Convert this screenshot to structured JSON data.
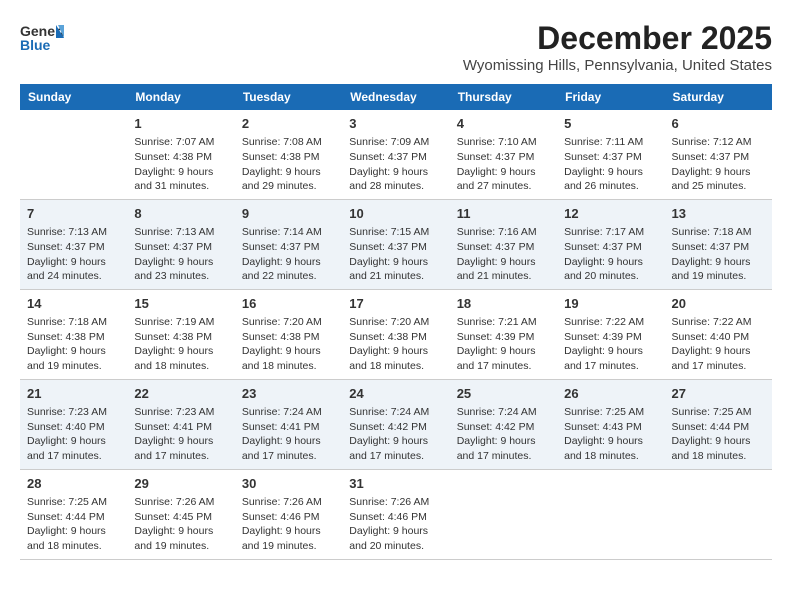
{
  "header": {
    "logo_general": "General",
    "logo_blue": "Blue",
    "month_title": "December 2025",
    "location": "Wyomissing Hills, Pennsylvania, United States"
  },
  "days_of_week": [
    "Sunday",
    "Monday",
    "Tuesday",
    "Wednesday",
    "Thursday",
    "Friday",
    "Saturday"
  ],
  "weeks": [
    [
      {
        "day": "",
        "info": ""
      },
      {
        "day": "1",
        "info": "Sunrise: 7:07 AM\nSunset: 4:38 PM\nDaylight: 9 hours\nand 31 minutes."
      },
      {
        "day": "2",
        "info": "Sunrise: 7:08 AM\nSunset: 4:38 PM\nDaylight: 9 hours\nand 29 minutes."
      },
      {
        "day": "3",
        "info": "Sunrise: 7:09 AM\nSunset: 4:37 PM\nDaylight: 9 hours\nand 28 minutes."
      },
      {
        "day": "4",
        "info": "Sunrise: 7:10 AM\nSunset: 4:37 PM\nDaylight: 9 hours\nand 27 minutes."
      },
      {
        "day": "5",
        "info": "Sunrise: 7:11 AM\nSunset: 4:37 PM\nDaylight: 9 hours\nand 26 minutes."
      },
      {
        "day": "6",
        "info": "Sunrise: 7:12 AM\nSunset: 4:37 PM\nDaylight: 9 hours\nand 25 minutes."
      }
    ],
    [
      {
        "day": "7",
        "info": "Sunrise: 7:13 AM\nSunset: 4:37 PM\nDaylight: 9 hours\nand 24 minutes."
      },
      {
        "day": "8",
        "info": "Sunrise: 7:13 AM\nSunset: 4:37 PM\nDaylight: 9 hours\nand 23 minutes."
      },
      {
        "day": "9",
        "info": "Sunrise: 7:14 AM\nSunset: 4:37 PM\nDaylight: 9 hours\nand 22 minutes."
      },
      {
        "day": "10",
        "info": "Sunrise: 7:15 AM\nSunset: 4:37 PM\nDaylight: 9 hours\nand 21 minutes."
      },
      {
        "day": "11",
        "info": "Sunrise: 7:16 AM\nSunset: 4:37 PM\nDaylight: 9 hours\nand 21 minutes."
      },
      {
        "day": "12",
        "info": "Sunrise: 7:17 AM\nSunset: 4:37 PM\nDaylight: 9 hours\nand 20 minutes."
      },
      {
        "day": "13",
        "info": "Sunrise: 7:18 AM\nSunset: 4:37 PM\nDaylight: 9 hours\nand 19 minutes."
      }
    ],
    [
      {
        "day": "14",
        "info": "Sunrise: 7:18 AM\nSunset: 4:38 PM\nDaylight: 9 hours\nand 19 minutes."
      },
      {
        "day": "15",
        "info": "Sunrise: 7:19 AM\nSunset: 4:38 PM\nDaylight: 9 hours\nand 18 minutes."
      },
      {
        "day": "16",
        "info": "Sunrise: 7:20 AM\nSunset: 4:38 PM\nDaylight: 9 hours\nand 18 minutes."
      },
      {
        "day": "17",
        "info": "Sunrise: 7:20 AM\nSunset: 4:38 PM\nDaylight: 9 hours\nand 18 minutes."
      },
      {
        "day": "18",
        "info": "Sunrise: 7:21 AM\nSunset: 4:39 PM\nDaylight: 9 hours\nand 17 minutes."
      },
      {
        "day": "19",
        "info": "Sunrise: 7:22 AM\nSunset: 4:39 PM\nDaylight: 9 hours\nand 17 minutes."
      },
      {
        "day": "20",
        "info": "Sunrise: 7:22 AM\nSunset: 4:40 PM\nDaylight: 9 hours\nand 17 minutes."
      }
    ],
    [
      {
        "day": "21",
        "info": "Sunrise: 7:23 AM\nSunset: 4:40 PM\nDaylight: 9 hours\nand 17 minutes."
      },
      {
        "day": "22",
        "info": "Sunrise: 7:23 AM\nSunset: 4:41 PM\nDaylight: 9 hours\nand 17 minutes."
      },
      {
        "day": "23",
        "info": "Sunrise: 7:24 AM\nSunset: 4:41 PM\nDaylight: 9 hours\nand 17 minutes."
      },
      {
        "day": "24",
        "info": "Sunrise: 7:24 AM\nSunset: 4:42 PM\nDaylight: 9 hours\nand 17 minutes."
      },
      {
        "day": "25",
        "info": "Sunrise: 7:24 AM\nSunset: 4:42 PM\nDaylight: 9 hours\nand 17 minutes."
      },
      {
        "day": "26",
        "info": "Sunrise: 7:25 AM\nSunset: 4:43 PM\nDaylight: 9 hours\nand 18 minutes."
      },
      {
        "day": "27",
        "info": "Sunrise: 7:25 AM\nSunset: 4:44 PM\nDaylight: 9 hours\nand 18 minutes."
      }
    ],
    [
      {
        "day": "28",
        "info": "Sunrise: 7:25 AM\nSunset: 4:44 PM\nDaylight: 9 hours\nand 18 minutes."
      },
      {
        "day": "29",
        "info": "Sunrise: 7:26 AM\nSunset: 4:45 PM\nDaylight: 9 hours\nand 19 minutes."
      },
      {
        "day": "30",
        "info": "Sunrise: 7:26 AM\nSunset: 4:46 PM\nDaylight: 9 hours\nand 19 minutes."
      },
      {
        "day": "31",
        "info": "Sunrise: 7:26 AM\nSunset: 4:46 PM\nDaylight: 9 hours\nand 20 minutes."
      },
      {
        "day": "",
        "info": ""
      },
      {
        "day": "",
        "info": ""
      },
      {
        "day": "",
        "info": ""
      }
    ]
  ]
}
